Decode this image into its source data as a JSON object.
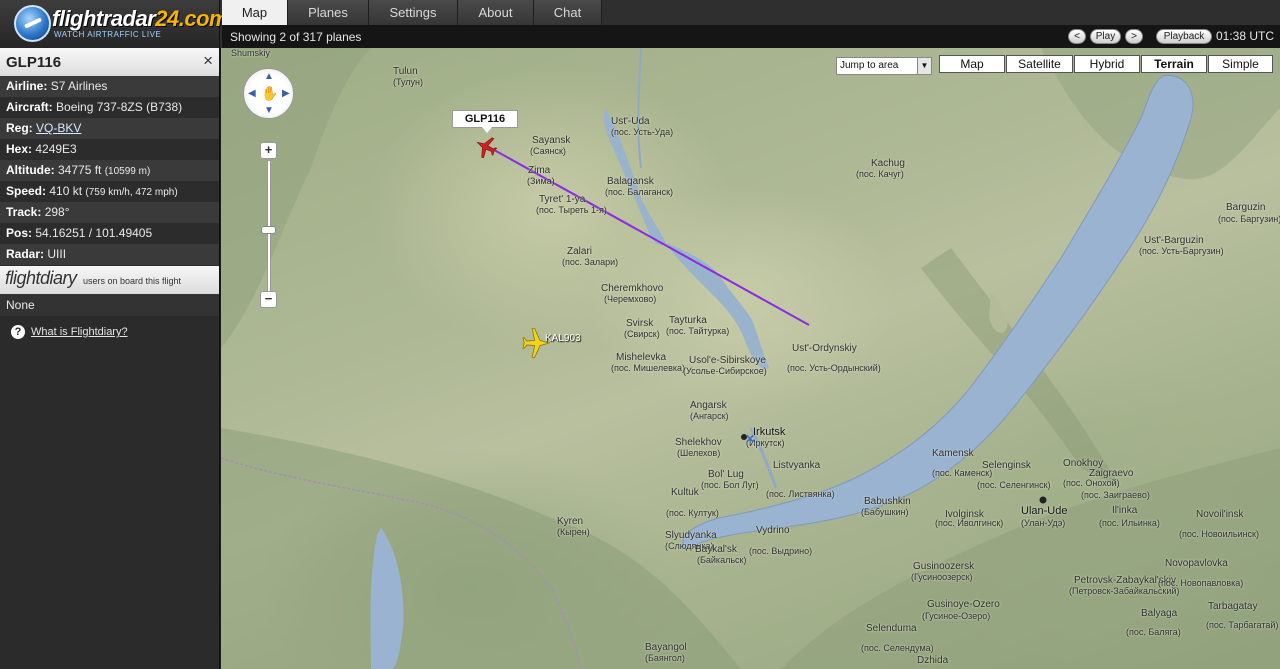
{
  "app": {
    "brand_main": "flightradar",
    "brand_accent": "24.com",
    "tagline": "WATCH AIRTRAFFIC LIVE"
  },
  "tabs": [
    {
      "label": "Map",
      "active": true
    },
    {
      "label": "Planes",
      "active": false
    },
    {
      "label": "Settings",
      "active": false
    },
    {
      "label": "About",
      "active": false
    },
    {
      "label": "Chat",
      "active": false
    }
  ],
  "status": {
    "showing": "Showing 2 of 317 planes",
    "prev": "<",
    "play": "Play",
    "next": ">",
    "playback": "Playback",
    "time": "01:38 UTC"
  },
  "flight": {
    "callsign": "GLP116",
    "close": "×",
    "airline_label": "Airline:",
    "airline": "S7 Airlines",
    "aircraft_label": "Aircraft:",
    "aircraft": "Boeing 737-8ZS",
    "aircraft_code": "(B738)",
    "reg_label": "Reg:",
    "reg": "VQ-BKV",
    "hex_label": "Hex:",
    "hex": "4249E3",
    "altitude_label": "Altitude:",
    "altitude": "34775 ft",
    "altitude_m": "(10599 m)",
    "speed_label": "Speed:",
    "speed": "410 kt",
    "speed_extra": "(759 km/h, 472 mph)",
    "track_label": "Track:",
    "track": "298°",
    "pos_label": "Pos:",
    "pos": "54.16251 / 101.49405",
    "radar_label": "Radar:",
    "radar": "UIII"
  },
  "flightdiary": {
    "logo": "flightdiary",
    "subtitle": "users on board this flight",
    "value": "None",
    "help_icon": "?",
    "help_link": "What is Flightdiary?"
  },
  "map_controls": {
    "jump_to_area": "Jump to area",
    "types": [
      {
        "label": "Map",
        "active": false
      },
      {
        "label": "Satellite",
        "active": false
      },
      {
        "label": "Hybrid",
        "active": false
      },
      {
        "label": "Terrain",
        "active": true
      },
      {
        "label": "Simple",
        "active": false
      }
    ],
    "zoom_in": "+",
    "zoom_out": "−",
    "pan_icon": "hand-pan-icon"
  },
  "aircraft_on_map": [
    {
      "callsign": "GLP116",
      "color": "#cc2222",
      "selected": true
    },
    {
      "callsign": "KAL903",
      "color": "#f2d21b",
      "selected": false
    }
  ],
  "places": [
    {
      "name": "Shumskiy",
      "sub": ""
    },
    {
      "name": "Tulun",
      "sub": "(Тулун)"
    },
    {
      "name": "Sayansk",
      "sub": "(Саянск)"
    },
    {
      "name": "Zima",
      "sub": "(Зима)"
    },
    {
      "name": "Tyret' 1-ya",
      "sub": "(пос. Тыреть 1-я)"
    },
    {
      "name": "Ust'-Uda",
      "sub": "(пос. Усть-Уда)"
    },
    {
      "name": "Balagansk",
      "sub": "(пос. Балаганск)"
    },
    {
      "name": "Kachug",
      "sub": "(пос. Качуг)"
    },
    {
      "name": "Zalari",
      "sub": "(пос. Залари)"
    },
    {
      "name": "Cheremkhovo",
      "sub": "(Черемхово)"
    },
    {
      "name": "Tayturka",
      "sub": "(пос. Тайтурка)"
    },
    {
      "name": "Svirsk",
      "sub": "(Свирск)"
    },
    {
      "name": "Mishelevka",
      "sub": "(пос. Мишелевка)"
    },
    {
      "name": "Usol'e-Sibirskoye",
      "sub": "(Усолье-Сибирское)"
    },
    {
      "name": "Ust'-Ordynskiy",
      "sub": "(пос. Усть-Ордынский)"
    },
    {
      "name": "Angarsk",
      "sub": "(Ангарск)"
    },
    {
      "name": "Irkutsk",
      "sub": "(Иркутск)"
    },
    {
      "name": "Shelekhov",
      "sub": "(Шелехов)"
    },
    {
      "name": "Bol' Lug",
      "sub": "(пос. Бол Луг)"
    },
    {
      "name": "Listvyanka",
      "sub": "(пос. Листвянка)"
    },
    {
      "name": "Kultuk",
      "sub": "(пос. Култук)"
    },
    {
      "name": "Kyren",
      "sub": "(Кырен)"
    },
    {
      "name": "Slyudyanka",
      "sub": "(Слюдянка)"
    },
    {
      "name": "Baykal'sk",
      "sub": "(Байкальск)"
    },
    {
      "name": "Vydrino",
      "sub": "(пос. Выдрино)"
    },
    {
      "name": "Babushkin",
      "sub": "(Бабушкин)"
    },
    {
      "name": "Kamensk",
      "sub": "(пос. Каменск)"
    },
    {
      "name": "Selenginsk",
      "sub": "(пос. Селенгинск)"
    },
    {
      "name": "Onokhoy",
      "sub": "(пос. Онохой)"
    },
    {
      "name": "Zaigraevo",
      "sub": "(пос. Заиграево)"
    },
    {
      "name": "Ulan-Ude",
      "sub": "(Улан-Удэ)"
    },
    {
      "name": "Il'inka",
      "sub": "(пос. Ильинка)"
    },
    {
      "name": "Novoil'insk",
      "sub": "(пос. Новоильинск)"
    },
    {
      "name": "Ivolginsk",
      "sub": "(пос. Иволгинск)"
    },
    {
      "name": "Gusinoozersk",
      "sub": "(Гусиноозерск)"
    },
    {
      "name": "Gusinoye-Ozero",
      "sub": "(Гусиное-Озеро)"
    },
    {
      "name": "Petrovsk-Zabaykal'skiy",
      "sub": "(Петровск-Забайкальский)"
    },
    {
      "name": "Novopavlovka",
      "sub": "(пос. Новопавловка)"
    },
    {
      "name": "Tarbagatay",
      "sub": "(пос. Тарбагатай)"
    },
    {
      "name": "Balyaga",
      "sub": "(пос. Балягa)"
    },
    {
      "name": "Selenduma",
      "sub": "(пос. Селендума)"
    },
    {
      "name": "Bayangol",
      "sub": "(Баянгол)"
    },
    {
      "name": "Dzhida",
      "sub": ""
    },
    {
      "name": "Barguzin",
      "sub": "(пос. Баргузин)"
    },
    {
      "name": "Ust'-Barguzin",
      "sub": "(пос. Усть-Баргузин)"
    }
  ]
}
